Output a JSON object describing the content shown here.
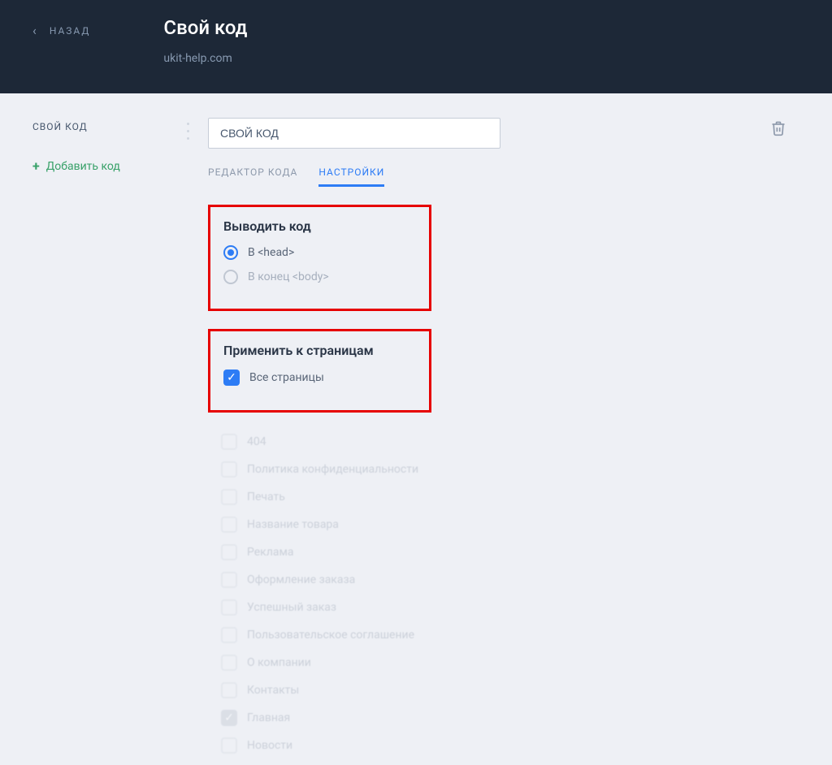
{
  "header": {
    "back_label": "НАЗАД",
    "title": "Свой код",
    "subtitle": "ukit-help.com"
  },
  "sidebar": {
    "item_label": "СВОЙ КОД",
    "add_label": "Добавить код"
  },
  "toolbar": {
    "code_name_value": "СВОЙ КОД"
  },
  "tabs": {
    "editor": "РЕДАКТОР КОДА",
    "settings": "НАСТРОЙКИ"
  },
  "section_output": {
    "title": "Выводить код",
    "opt_head": "В <head>",
    "opt_body": "В конец <body>"
  },
  "section_apply": {
    "title": "Применить к страницам",
    "all_pages": "Все страницы"
  },
  "pages": [
    {
      "label": "404",
      "selected": false
    },
    {
      "label": "Политика конфиденциальности",
      "selected": false
    },
    {
      "label": "Печать",
      "selected": false
    },
    {
      "label": "Название товара",
      "selected": false
    },
    {
      "label": "Реклама",
      "selected": false
    },
    {
      "label": "Оформление заказа",
      "selected": false
    },
    {
      "label": "Успешный заказ",
      "selected": false
    },
    {
      "label": "Пользовательское соглашение",
      "selected": false
    },
    {
      "label": "О компании",
      "selected": false
    },
    {
      "label": "Контакты",
      "selected": false
    },
    {
      "label": "Главная",
      "selected": true
    },
    {
      "label": "Новости",
      "selected": false
    }
  ]
}
